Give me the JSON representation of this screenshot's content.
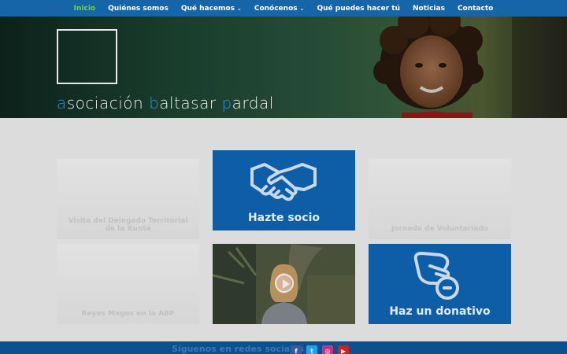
{
  "nav": {
    "items": [
      {
        "label": "Inicio",
        "active": true,
        "dropdown": false
      },
      {
        "label": "Quiénes somos",
        "active": false,
        "dropdown": false
      },
      {
        "label": "Qué hacemos",
        "active": false,
        "dropdown": true
      },
      {
        "label": "Conócenos",
        "active": false,
        "dropdown": true
      },
      {
        "label": "Qué puedes hacer tú",
        "active": false,
        "dropdown": false
      },
      {
        "label": "Noticias",
        "active": false,
        "dropdown": false
      },
      {
        "label": "Contacto",
        "active": false,
        "dropdown": false
      }
    ]
  },
  "hero": {
    "org_name": {
      "a1": "a",
      "p1": "sociación ",
      "a2": "b",
      "p2": "altasar ",
      "a3": "p",
      "p3": "ardal"
    }
  },
  "tiles": {
    "visita": {
      "caption": "Visita del Delegado Territorial de la Xunta"
    },
    "hazte_socio": {
      "caption": "Hazte socio",
      "icon": "handshake-icon"
    },
    "voluntariado": {
      "caption": "Jornada de Voluntariado"
    },
    "reyes": {
      "caption": "Reyes Magos en la ABP"
    },
    "video": {
      "icon": "play-icon"
    },
    "donativo": {
      "caption": "Haz un donativo",
      "icon": "donate-hand-icon"
    }
  },
  "footer": {
    "follow_text": "Síguenos en redes sociales",
    "social": [
      {
        "name": "facebook-icon",
        "glyph": "f",
        "color": "#3b5998"
      },
      {
        "name": "twitter-icon",
        "glyph": "t",
        "color": "#1da1f2"
      },
      {
        "name": "instagram-icon",
        "glyph": "◎",
        "color": "#c13584"
      },
      {
        "name": "youtube-icon",
        "glyph": "▶",
        "color": "#cd201f"
      }
    ]
  },
  "colors": {
    "nav_bg": "#1565a8",
    "nav_active": "#6bdc2d",
    "tile_blue": "#0d5ea7",
    "logo_accent": "#2e8ee0",
    "footer_bg": "#0e4f8e"
  }
}
